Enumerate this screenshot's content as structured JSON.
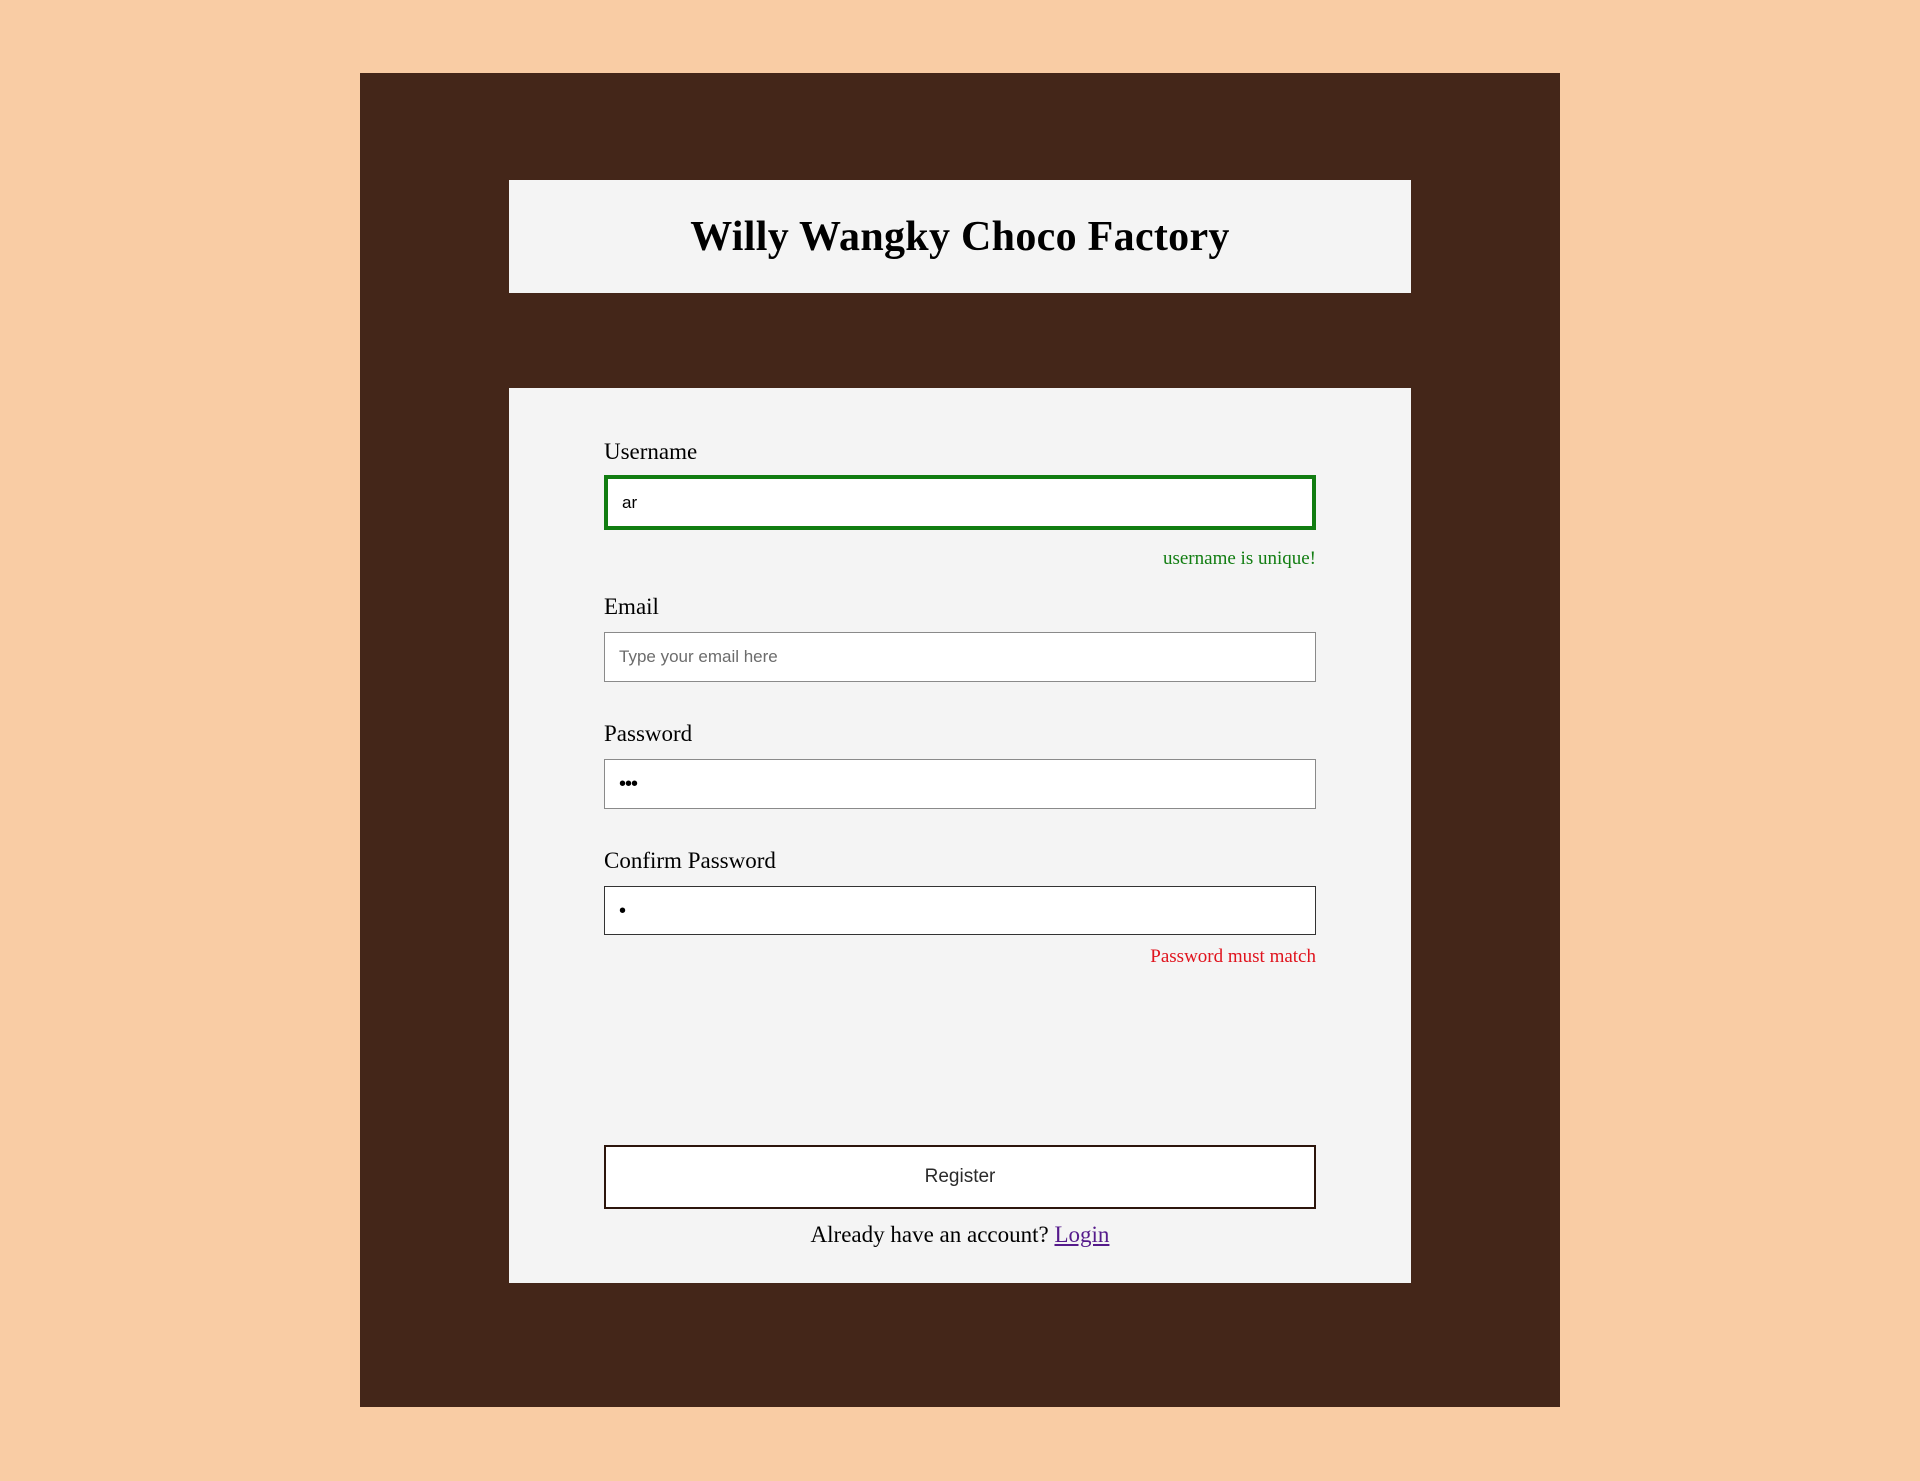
{
  "header": {
    "title": "Willy Wangky Choco Factory"
  },
  "form": {
    "username": {
      "label": "Username",
      "value": "ar",
      "message": "username is unique!"
    },
    "email": {
      "label": "Email",
      "value": "",
      "placeholder": "Type your email here"
    },
    "password": {
      "label": "Password",
      "masked_value": "•••"
    },
    "confirm_password": {
      "label": "Confirm Password",
      "masked_value": "•",
      "message": "Password must match"
    },
    "register_label": "Register"
  },
  "footer": {
    "prompt": "Already have an account?",
    "login_label": "Login"
  },
  "colors": {
    "page_background": "#f9cca4",
    "frame": "#442619",
    "card": "#f4f4f4",
    "success": "#117d11",
    "error": "#e0131d",
    "link": "#551a8b"
  }
}
